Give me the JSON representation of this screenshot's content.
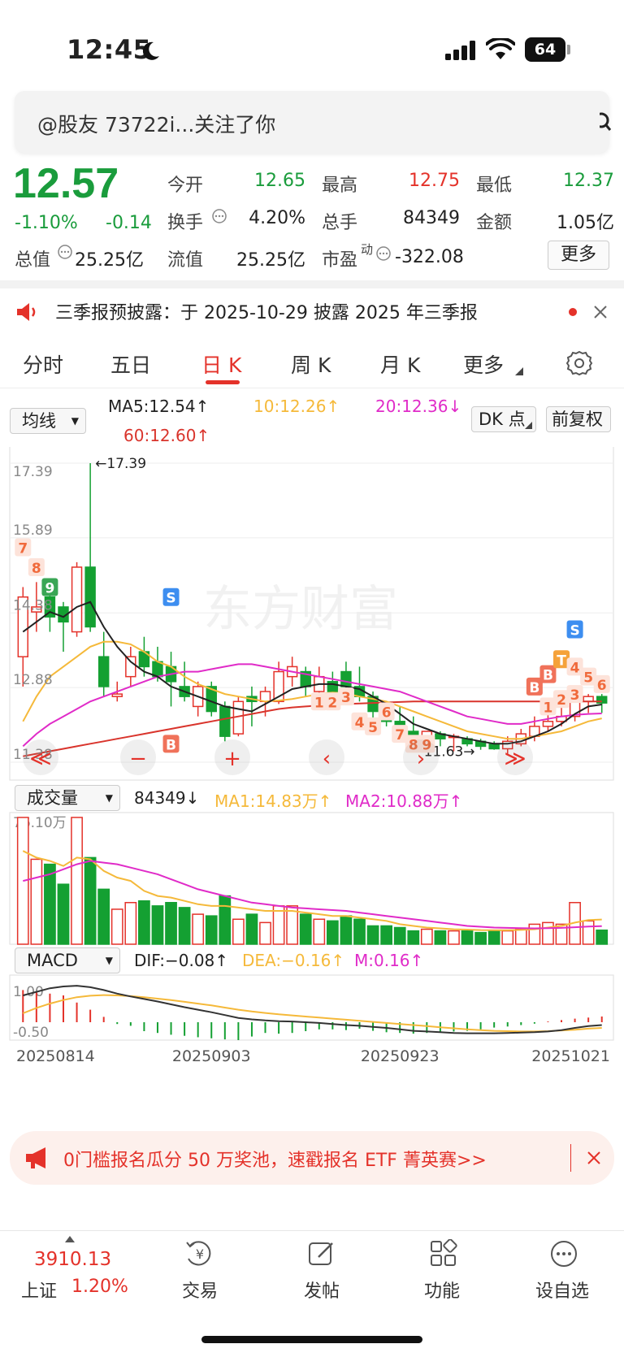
{
  "status_bar": {
    "time": "12:45",
    "battery": "64"
  },
  "notice": {
    "text": "@股友 73722i...关注了你"
  },
  "quote": {
    "price": "12.57",
    "change_pct": "-1.10%",
    "change": "-0.14",
    "open_label": "今开",
    "open": "12.65",
    "high_label": "最高",
    "high": "12.75",
    "low_label": "最低",
    "low": "12.37",
    "turnover_label": "换手",
    "turnover": "4.20%",
    "volume_label": "总手",
    "volume": "84349",
    "amount_label": "金额",
    "amount": "1.05亿",
    "mktcap_label": "总值",
    "mktcap": "25.25亿",
    "float_label": "流值",
    "float": "25.25亿",
    "pe_label": "市盈",
    "pe_sup": "动",
    "pe": "-322.08",
    "more_button": "更多"
  },
  "announcement": {
    "text": "三季报预披露：于 2025-10-29 披露 2025 年三季报"
  },
  "tabs": [
    {
      "label": "分时",
      "active": false
    },
    {
      "label": "五日",
      "active": false
    },
    {
      "label": "日 K",
      "active": true
    },
    {
      "label": "周 K",
      "active": false
    },
    {
      "label": "月 K",
      "active": false
    },
    {
      "label": "更多",
      "active": false
    }
  ],
  "kline_controls": {
    "indicator_select": "均线",
    "ma5": "MA5:12.54↑",
    "ma10": "10:12.26↑",
    "ma20": "20:12.36↓",
    "ma60": "60:12.60↑",
    "dk_button": "DK 点",
    "adjust_button": "前复权"
  },
  "volume_controls": {
    "select": "成交量",
    "volume": "84349↓",
    "ma1": "MA1:14.83万↑",
    "ma2": "MA2:10.88万↑"
  },
  "macd_controls": {
    "select": "MACD",
    "dif": "DIF:−0.08↑",
    "dea": "DEA:−0.16↑",
    "m": "M:0.16↑"
  },
  "colors": {
    "up": "#e4322a",
    "down": "#14a032",
    "ma5": "#222222",
    "ma10": "#f5b93a",
    "ma20": "#e02bc8",
    "ma60": "#d9342c"
  },
  "chart_data": {
    "type": "candlestick",
    "y_ticks": [
      "17.39",
      "15.89",
      "14.38",
      "12.88",
      "11.38"
    ],
    "ylim": [
      11.38,
      17.39
    ],
    "max_label": "←17.39",
    "min_label": "11.63→",
    "x_labels": [
      "20250814",
      "20250903",
      "20250923",
      "20251021"
    ],
    "candles": [
      {
        "o": 13.5,
        "c": 14.7,
        "h": 14.9,
        "l": 12.9
      },
      {
        "o": 14.4,
        "c": 14.5,
        "h": 15.0,
        "l": 14.0
      },
      {
        "o": 14.7,
        "c": 14.3,
        "h": 14.9,
        "l": 14.0
      },
      {
        "o": 14.5,
        "c": 14.2,
        "h": 14.6,
        "l": 13.6
      },
      {
        "o": 14.0,
        "c": 15.3,
        "h": 15.4,
        "l": 13.9
      },
      {
        "o": 15.3,
        "c": 14.1,
        "h": 17.39,
        "l": 14.0
      },
      {
        "o": 13.5,
        "c": 12.9,
        "h": 14.0,
        "l": 12.7
      },
      {
        "o": 12.7,
        "c": 12.75,
        "h": 13.0,
        "l": 12.6
      },
      {
        "o": 13.1,
        "c": 13.5,
        "h": 13.7,
        "l": 12.9
      },
      {
        "o": 13.6,
        "c": 13.3,
        "h": 13.9,
        "l": 13.1
      },
      {
        "o": 13.4,
        "c": 13.1,
        "h": 13.7,
        "l": 13.0
      },
      {
        "o": 13.3,
        "c": 13.0,
        "h": 13.6,
        "l": 12.5
      },
      {
        "o": 12.9,
        "c": 12.7,
        "h": 13.4,
        "l": 12.6
      },
      {
        "o": 12.5,
        "c": 12.9,
        "h": 13.0,
        "l": 12.3
      },
      {
        "o": 12.9,
        "c": 12.4,
        "h": 13.0,
        "l": 12.3
      },
      {
        "o": 12.5,
        "c": 11.9,
        "h": 12.6,
        "l": 11.8
      },
      {
        "o": 11.95,
        "c": 12.6,
        "h": 12.7,
        "l": 11.9
      },
      {
        "o": 12.7,
        "c": 12.6,
        "h": 12.9,
        "l": 12.1
      },
      {
        "o": 12.6,
        "c": 12.8,
        "h": 12.9,
        "l": 12.3
      },
      {
        "o": 12.6,
        "c": 13.2,
        "h": 13.4,
        "l": 12.55
      },
      {
        "o": 13.1,
        "c": 13.3,
        "h": 13.5,
        "l": 12.9
      },
      {
        "o": 13.2,
        "c": 12.9,
        "h": 13.3,
        "l": 12.7
      },
      {
        "o": 12.8,
        "c": 13.1,
        "h": 13.3,
        "l": 12.7
      },
      {
        "o": 13.0,
        "c": 12.8,
        "h": 13.2,
        "l": 12.6
      },
      {
        "o": 13.2,
        "c": 12.9,
        "h": 13.4,
        "l": 12.6
      },
      {
        "o": 12.9,
        "c": 12.7,
        "h": 13.3,
        "l": 12.6
      },
      {
        "o": 12.7,
        "c": 12.4,
        "h": 12.8,
        "l": 12.2
      },
      {
        "o": 12.4,
        "c": 12.2,
        "h": 12.5,
        "l": 12.1
      },
      {
        "o": 12.2,
        "c": 12.0,
        "h": 12.5,
        "l": 11.8
      },
      {
        "o": 12.0,
        "c": 11.9,
        "h": 12.3,
        "l": 11.75
      },
      {
        "o": 11.9,
        "c": 12.0,
        "h": 12.0,
        "l": 11.65
      },
      {
        "o": 11.95,
        "c": 11.85,
        "h": 12.0,
        "l": 11.7
      },
      {
        "o": 11.9,
        "c": 11.9,
        "h": 11.95,
        "l": 11.6
      },
      {
        "o": 11.85,
        "c": 11.75,
        "h": 11.9,
        "l": 11.7
      },
      {
        "o": 11.8,
        "c": 11.7,
        "h": 11.85,
        "l": 11.63
      },
      {
        "o": 11.75,
        "c": 11.65,
        "h": 11.8,
        "l": 11.63
      },
      {
        "o": 11.65,
        "c": 11.8,
        "h": 11.9,
        "l": 11.55
      },
      {
        "o": 11.75,
        "c": 11.95,
        "h": 12.05,
        "l": 11.7
      },
      {
        "o": 11.9,
        "c": 12.1,
        "h": 12.3,
        "l": 11.8
      },
      {
        "o": 12.1,
        "c": 12.2,
        "h": 12.4,
        "l": 12.0
      },
      {
        "o": 12.2,
        "c": 12.3,
        "h": 12.8,
        "l": 12.1
      },
      {
        "o": 12.3,
        "c": 12.6,
        "h": 12.9,
        "l": 12.2
      },
      {
        "o": 12.6,
        "c": 12.7,
        "h": 12.75,
        "l": 12.37
      },
      {
        "o": 12.7,
        "c": 12.57,
        "h": 12.75,
        "l": 12.37
      }
    ],
    "ma5": [
      14.0,
      14.2,
      14.4,
      14.3,
      14.5,
      14.6,
      14.1,
      13.7,
      13.4,
      13.2,
      13.1,
      12.9,
      12.8,
      12.7,
      12.6,
      12.5,
      12.45,
      12.4,
      12.55,
      12.7,
      12.85,
      12.9,
      12.95,
      12.95,
      12.9,
      12.85,
      12.7,
      12.55,
      12.35,
      12.15,
      12.05,
      11.95,
      11.9,
      11.85,
      11.8,
      11.75,
      11.75,
      11.8,
      11.9,
      12.0,
      12.15,
      12.35,
      12.5,
      12.54
    ],
    "ma10": [
      12.2,
      12.7,
      13.1,
      13.3,
      13.5,
      13.7,
      13.8,
      13.8,
      13.75,
      13.6,
      13.4,
      13.3,
      13.1,
      12.95,
      12.85,
      12.75,
      12.7,
      12.65,
      12.6,
      12.62,
      12.65,
      12.7,
      12.75,
      12.78,
      12.76,
      12.7,
      12.65,
      12.6,
      12.5,
      12.4,
      12.3,
      12.2,
      12.1,
      12.0,
      11.95,
      11.9,
      11.85,
      11.85,
      11.9,
      11.95,
      12.0,
      12.1,
      12.2,
      12.26
    ],
    "ma20": [
      11.7,
      11.95,
      12.15,
      12.3,
      12.45,
      12.6,
      12.7,
      12.8,
      12.9,
      13.0,
      13.1,
      13.15,
      13.2,
      13.2,
      13.25,
      13.3,
      13.35,
      13.35,
      13.3,
      13.25,
      13.2,
      13.15,
      13.1,
      13.05,
      13.0,
      12.95,
      12.9,
      12.85,
      12.8,
      12.7,
      12.6,
      12.5,
      12.4,
      12.3,
      12.25,
      12.2,
      12.15,
      12.15,
      12.2,
      12.25,
      12.3,
      12.33,
      12.35,
      12.36
    ],
    "ma60": [
      11.5,
      11.55,
      11.6,
      11.65,
      11.7,
      11.75,
      11.8,
      11.85,
      11.9,
      11.95,
      12.0,
      12.05,
      12.1,
      12.15,
      12.2,
      12.25,
      12.3,
      12.35,
      12.4,
      12.45,
      12.48,
      12.5,
      12.52,
      12.54,
      12.55,
      12.56,
      12.57,
      12.58,
      12.59,
      12.6,
      12.6,
      12.6,
      12.6,
      12.6,
      12.6,
      12.6,
      12.6,
      12.6,
      12.6,
      12.6,
      12.6,
      12.6,
      12.6,
      12.6
    ],
    "volume_top_label": "76.10万",
    "volume_max": 761000,
    "volumes": [
      761000,
      510000,
      480000,
      360000,
      761000,
      520000,
      330000,
      210000,
      250000,
      260000,
      230000,
      250000,
      220000,
      180000,
      170000,
      290000,
      150000,
      180000,
      130000,
      230000,
      230000,
      180000,
      150000,
      140000,
      170000,
      150000,
      110000,
      110000,
      100000,
      80000,
      90000,
      80000,
      80000,
      80000,
      70000,
      80000,
      80000,
      90000,
      120000,
      130000,
      120000,
      250000,
      140000,
      84349
    ],
    "volume_ma1": [
      560000,
      520000,
      500000,
      470000,
      520000,
      510000,
      440000,
      400000,
      380000,
      320000,
      290000,
      280000,
      260000,
      240000,
      230000,
      230000,
      220000,
      210000,
      200000,
      200000,
      200000,
      190000,
      180000,
      170000,
      170000,
      160000,
      150000,
      140000,
      120000,
      110000,
      100000,
      95000,
      90000,
      88000,
      85000,
      84000,
      84000,
      86000,
      90000,
      100000,
      110000,
      130000,
      145000,
      148300
    ],
    "volume_ma2": [
      380000,
      400000,
      420000,
      450000,
      480000,
      500000,
      490000,
      480000,
      460000,
      440000,
      420000,
      390000,
      360000,
      330000,
      310000,
      290000,
      270000,
      250000,
      240000,
      230000,
      220000,
      215000,
      210000,
      205000,
      200000,
      190000,
      180000,
      170000,
      160000,
      150000,
      140000,
      130000,
      120000,
      110000,
      105000,
      100000,
      98000,
      96000,
      95000,
      96000,
      98000,
      102000,
      106000,
      108800
    ],
    "macd_ylim": [
      -0.5,
      1.0
    ],
    "macd_ticks": [
      "1.00",
      "-0.50"
    ],
    "macd_hist": [
      0.9,
      0.85,
      0.8,
      0.75,
      0.55,
      0.35,
      0.15,
      -0.05,
      -0.1,
      -0.25,
      -0.3,
      -0.35,
      -0.38,
      -0.42,
      -0.45,
      -0.48,
      -0.5,
      -0.4,
      -0.3,
      -0.32,
      -0.3,
      -0.25,
      -0.2,
      -0.2,
      -0.22,
      -0.18,
      -0.24,
      -0.28,
      -0.3,
      -0.32,
      -0.3,
      -0.28,
      -0.26,
      -0.24,
      -0.2,
      -0.15,
      -0.12,
      -0.08,
      -0.04,
      0.02,
      0.06,
      0.1,
      0.13,
      0.16
    ],
    "macd_dif": [
      0.75,
      0.85,
      0.95,
      1.0,
      1.02,
      0.98,
      0.9,
      0.8,
      0.72,
      0.65,
      0.58,
      0.5,
      0.42,
      0.35,
      0.28,
      0.2,
      0.12,
      0.08,
      0.05,
      0.03,
      0.02,
      0.0,
      -0.02,
      -0.05,
      -0.08,
      -0.1,
      -0.13,
      -0.16,
      -0.2,
      -0.24,
      -0.26,
      -0.28,
      -0.3,
      -0.31,
      -0.31,
      -0.31,
      -0.3,
      -0.29,
      -0.28,
      -0.26,
      -0.22,
      -0.16,
      -0.11,
      -0.08
    ],
    "macd_dea": [
      0.25,
      0.4,
      0.52,
      0.62,
      0.7,
      0.74,
      0.76,
      0.75,
      0.73,
      0.7,
      0.66,
      0.62,
      0.57,
      0.52,
      0.47,
      0.41,
      0.35,
      0.3,
      0.26,
      0.22,
      0.19,
      0.16,
      0.13,
      0.1,
      0.07,
      0.04,
      0.01,
      -0.02,
      -0.05,
      -0.08,
      -0.11,
      -0.14,
      -0.17,
      -0.2,
      -0.22,
      -0.24,
      -0.25,
      -0.26,
      -0.26,
      -0.25,
      -0.23,
      -0.21,
      -0.18,
      -0.16
    ]
  },
  "signals": [
    "7",
    "8",
    "9",
    "S",
    "B",
    "1",
    "2",
    "3",
    "4",
    "5",
    "6",
    "7",
    "8",
    "9",
    "B",
    "B",
    "T",
    "1",
    "2",
    "3",
    "4",
    "5",
    "6",
    "S"
  ],
  "chart_nav": {
    "first": "≪",
    "zoom_out": "−",
    "zoom_in": "+",
    "prev": "‹",
    "next": "›",
    "last": "≫"
  },
  "watermark": "东方财富",
  "promo": {
    "text": "0门槛报名瓜分 50 万奖池，速戳报名 ETF 菁英赛>>"
  },
  "bottom_nav": {
    "index_value": "3910.13",
    "index_name": "上证",
    "index_change": "1.20%",
    "items": [
      "交易",
      "发帖",
      "功能",
      "设自选"
    ]
  }
}
